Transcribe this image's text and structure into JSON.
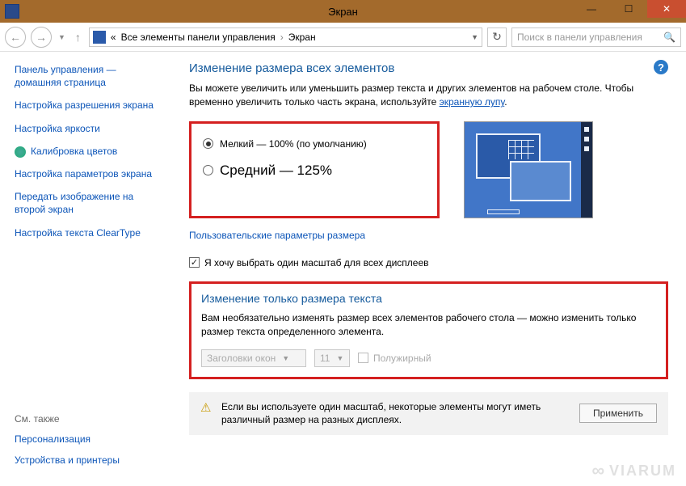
{
  "window": {
    "title": "Экран"
  },
  "nav": {
    "breadcrumb_prefix": "«",
    "breadcrumb1": "Все элементы панели управления",
    "breadcrumb2": "Экран",
    "search_placeholder": "Поиск в панели управления"
  },
  "sidebar": {
    "items": [
      "Панель управления — домашняя страница",
      "Настройка разрешения экрана",
      "Настройка яркости",
      "Калибровка цветов",
      "Настройка параметров экрана",
      "Передать изображение на второй экран",
      "Настройка текста ClearType"
    ],
    "see_also_header": "См. также",
    "see_also": [
      "Персонализация",
      "Устройства и принтеры"
    ]
  },
  "main": {
    "title": "Изменение размера всех элементов",
    "desc_a": "Вы можете увеличить или уменьшить размер текста и других элементов на рабочем столе. Чтобы временно увеличить только часть экрана, используйте ",
    "desc_link": "экранную лупу",
    "desc_b": ".",
    "radios": {
      "opt1": "Мелкий — 100% (по умолчанию)",
      "opt2": "Средний — 125%"
    },
    "custom_link": "Пользовательские параметры размера",
    "checkbox_label": "Я хочу выбрать один масштаб для всех дисплеев",
    "text_section": {
      "title": "Изменение только размера текста",
      "desc": "Вам необязательно изменять размер всех элементов рабочего стола — можно изменить только размер текста определенного элемента.",
      "select1": "Заголовки окон",
      "select2": "11",
      "bold_label": "Полужирный"
    },
    "warning": "Если вы используете один масштаб, некоторые элементы могут иметь различный размер на разных дисплеях.",
    "apply_btn": "Применить"
  },
  "watermark": "VIARUM"
}
